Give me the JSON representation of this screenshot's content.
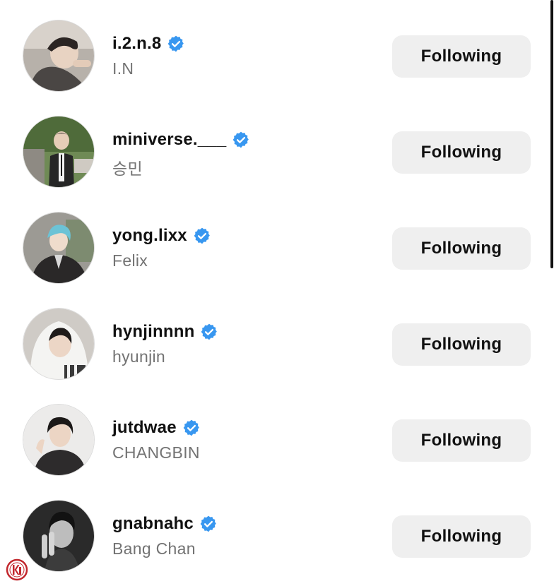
{
  "accent": "#3897f0",
  "button_bg": "#efefef",
  "accounts": [
    {
      "username": "i.2.n.8",
      "name": "I.N",
      "button": "Following",
      "verified": true
    },
    {
      "username": "miniverse.___",
      "name": "승민",
      "button": "Following",
      "verified": true
    },
    {
      "username": "yong.lixx",
      "name": "Felix",
      "button": "Following",
      "verified": true
    },
    {
      "username": "hynjinnnn",
      "name": "hyunjin",
      "button": "Following",
      "verified": true
    },
    {
      "username": "jutdwae",
      "name": "CHANGBIN",
      "button": "Following",
      "verified": true
    },
    {
      "username": "gnabnahc",
      "name": "Bang Chan",
      "button": "Following",
      "verified": true
    }
  ],
  "icons": {
    "verified": "verified-badge-icon",
    "watermark": "kpf-logo-icon"
  },
  "watermark_text": "KPF"
}
